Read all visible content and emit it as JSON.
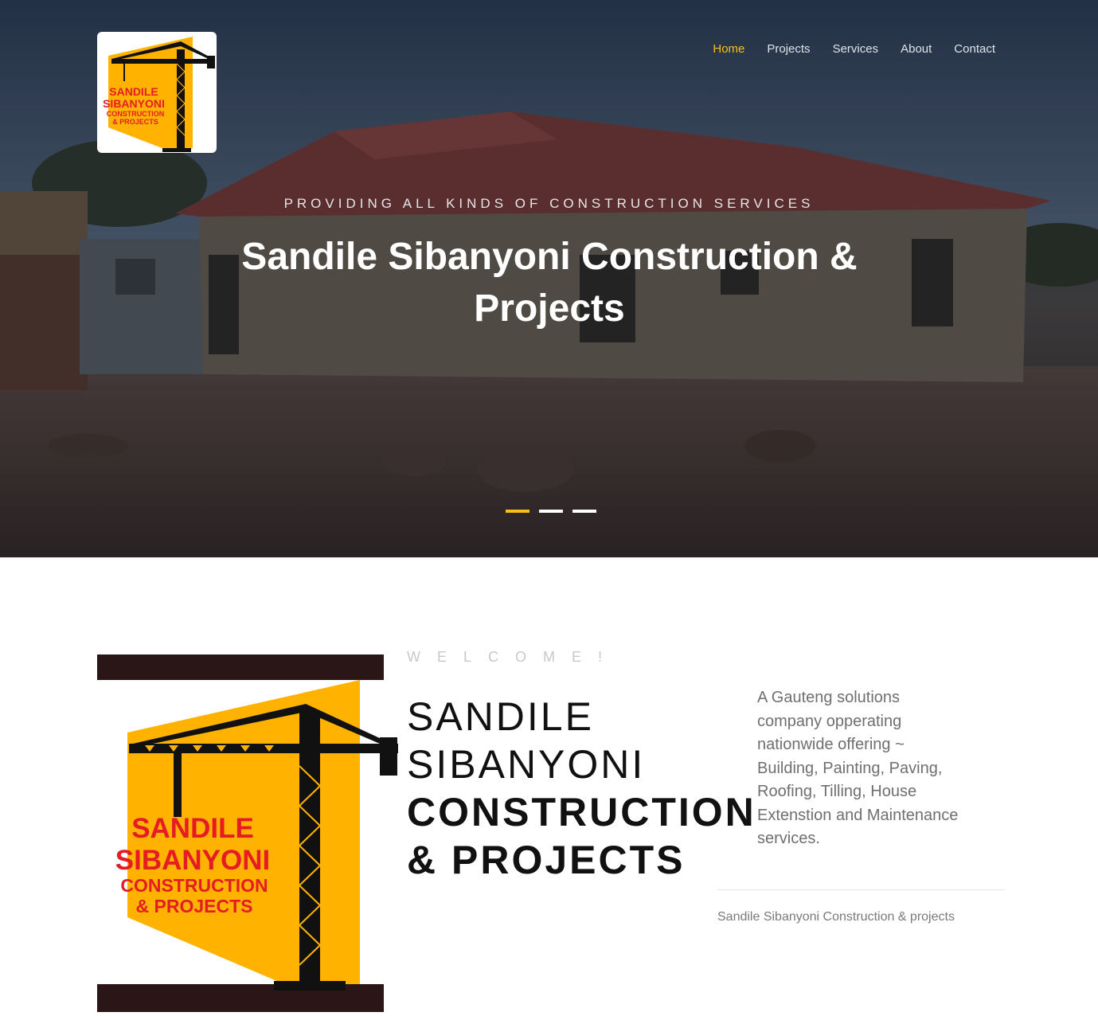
{
  "nav": {
    "items": [
      {
        "label": "Home",
        "active": true
      },
      {
        "label": "Projects",
        "active": false
      },
      {
        "label": "Services",
        "active": false
      },
      {
        "label": "About",
        "active": false
      },
      {
        "label": "Contact",
        "active": false
      }
    ]
  },
  "logo": {
    "line1": "SANDILE",
    "line2": "SIBANYONI",
    "line3": "CONSTRUCTION",
    "line4": "& PROJECTS"
  },
  "hero": {
    "kicker": "PROVIDING ALL KINDS OF CONSTRUCTION SERVICES",
    "title": "Sandile Sibanyoni Construction & Projects",
    "slides": {
      "count": 3,
      "active": 1
    }
  },
  "welcome": {
    "label": "WELCOME!",
    "name_line1": "SANDILE",
    "name_line2": "SIBANYONI",
    "name_line3": "CONSTRUCTION",
    "name_line4": "& PROJECTS",
    "description": "A Gauteng solutions company opperating nationwide offering ~ Building, Painting, Paving, Roofing, Tilling, House Extenstion and Maintenance services.",
    "footnote": "Sandile Sibanyoni Construction & projects"
  },
  "colors": {
    "accent": "#f6c01a",
    "logo_yellow": "#ffb300",
    "logo_red": "#e51c23",
    "logo_band": "#2a1616"
  },
  "icons": [
    "crane-logo-icon"
  ]
}
